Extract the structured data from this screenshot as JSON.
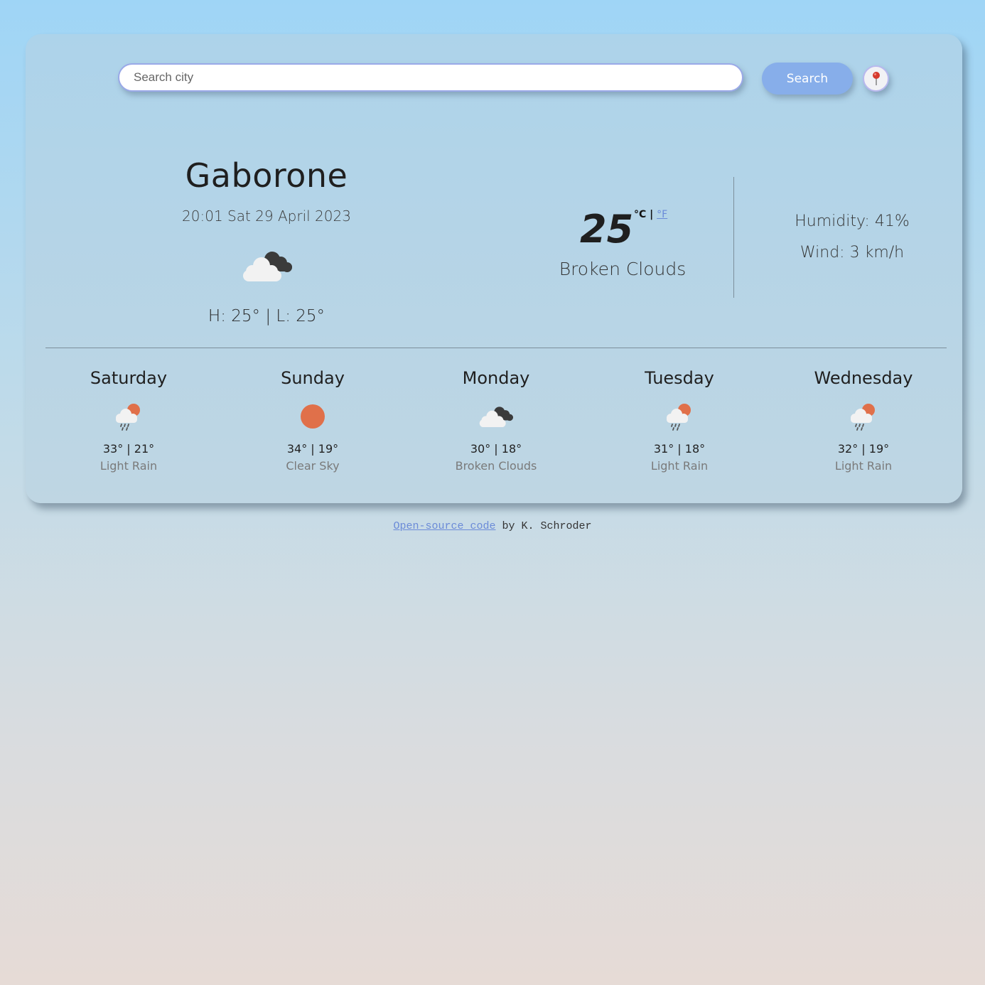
{
  "search": {
    "placeholder": "Search city",
    "button_label": "Search",
    "location_icon": "map-pin-icon"
  },
  "current": {
    "city": "Gaborone",
    "datetime": "20:01 Sat 29 April 2023",
    "icon": "broken-clouds-icon",
    "high_low": "H: 25° | L: 25°",
    "temperature": "25",
    "unit_celsius": "°C",
    "unit_separator": "|",
    "unit_fahrenheit": "°F",
    "condition": "Broken Clouds",
    "humidity": "Humidity: 41%",
    "wind": "Wind: 3 km/h"
  },
  "forecast": [
    {
      "day": "Saturday",
      "temps": "33° | 21°",
      "desc": "Light Rain",
      "icon": "light-rain-icon"
    },
    {
      "day": "Sunday",
      "temps": "34° | 19°",
      "desc": "Clear Sky",
      "icon": "sun-icon"
    },
    {
      "day": "Monday",
      "temps": "30° | 18°",
      "desc": "Broken Clouds",
      "icon": "broken-clouds-icon"
    },
    {
      "day": "Tuesday",
      "temps": "31° | 18°",
      "desc": "Light Rain",
      "icon": "light-rain-icon"
    },
    {
      "day": "Wednesday",
      "temps": "32° | 19°",
      "desc": "Light Rain",
      "icon": "light-rain-icon"
    }
  ],
  "footer": {
    "link_text": "Open-source code",
    "suffix": " by K. Schroder"
  },
  "colors": {
    "accent": "#87aeea",
    "sun": "#e0704a",
    "link": "#6a8ad8"
  }
}
